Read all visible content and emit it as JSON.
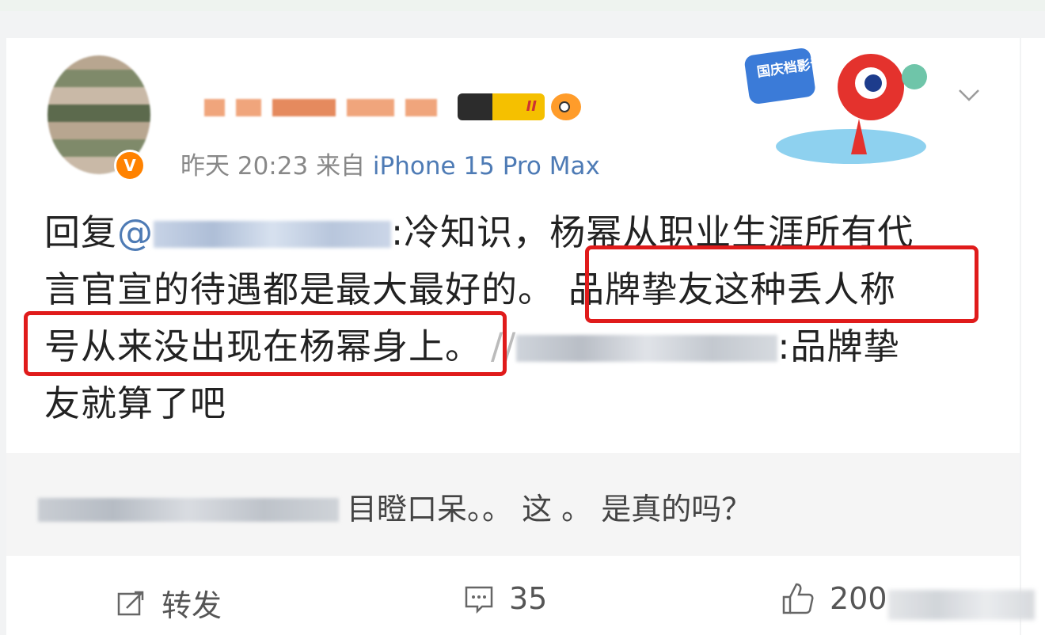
{
  "post": {
    "meta_time": "昨天 20:23",
    "meta_from": "来自",
    "meta_device": "iPhone 15 Pro Max",
    "level_badge": "II",
    "sticker_text": "国庆档影评达人",
    "reply_prefix": "回复",
    "reply_at": "@",
    "text_part1": ":冷知识，杨幂从职业生涯所有代",
    "text_part2": "言官宣的待遇都是最大最好的。",
    "text_highlight1": "品牌挚友这种丢人称",
    "text_highlight2": "号从来没出现在杨幂身上。",
    "text_part3": "//",
    "text_part4": ":品牌挚",
    "text_part5": "友就算了吧"
  },
  "comment": {
    "text": "目瞪口呆。。 这 。 是真的吗？"
  },
  "actions": {
    "repost_label": "转发",
    "comment_count": "35",
    "like_count": "200"
  },
  "colors": {
    "link": "#4e7bb5",
    "highlight_border": "#e01b1b",
    "vip_badge": "#ff8200"
  },
  "icons": {
    "repost": "repost-icon",
    "comment": "comment-icon",
    "like": "thumbs-up-icon",
    "menu": "chevron-down-icon"
  }
}
